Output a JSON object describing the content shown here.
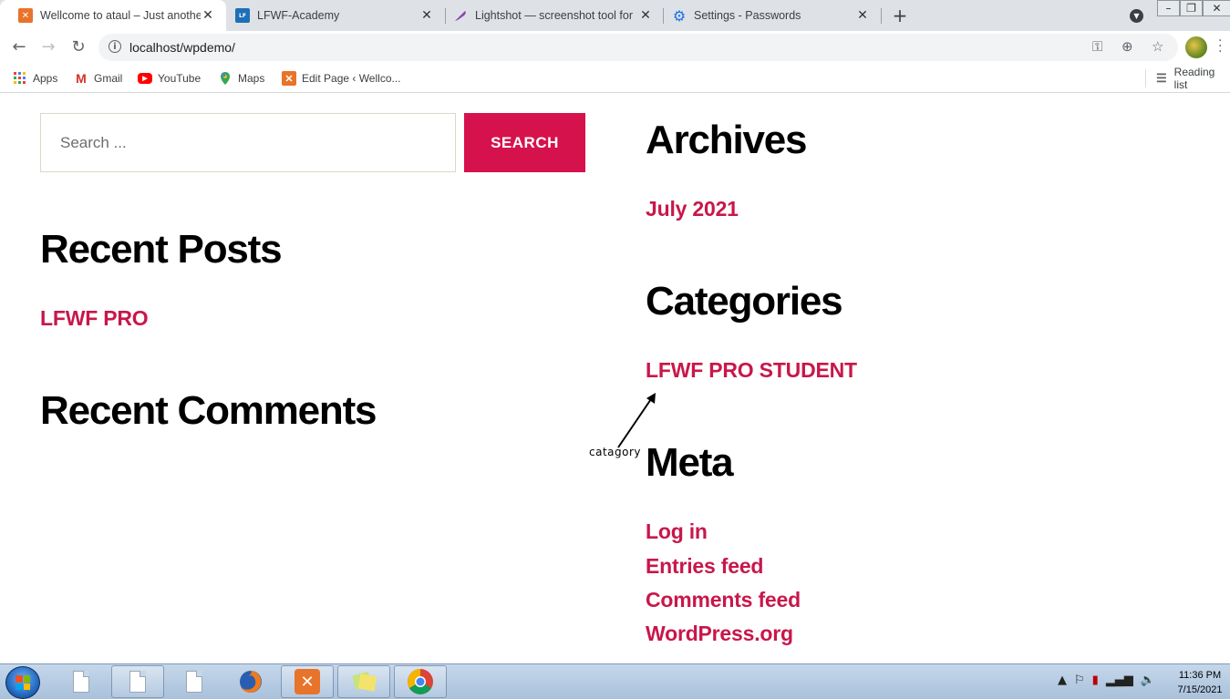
{
  "browser": {
    "tabs": [
      {
        "title": "Wellcome to ataul – Just another",
        "icon": "xampp-icon",
        "active": true
      },
      {
        "title": "LFWF-Academy",
        "icon": "lfwf-icon",
        "active": false
      },
      {
        "title": "Lightshot — screenshot tool for",
        "icon": "feather-icon",
        "active": false
      },
      {
        "title": "Settings - Passwords",
        "icon": "gear-icon",
        "active": false
      }
    ],
    "close_glyph": "✕",
    "new_tab_glyph": "+",
    "address": "localhost/wpdemo/",
    "bookmarks": [
      {
        "label": "Apps",
        "icon": "apps-grid-icon"
      },
      {
        "label": "Gmail",
        "icon": "gmail-icon"
      },
      {
        "label": "YouTube",
        "icon": "youtube-icon"
      },
      {
        "label": "Maps",
        "icon": "maps-icon"
      },
      {
        "label": "Edit Page ‹ Wellco...",
        "icon": "xampp-icon"
      }
    ],
    "reading_list": "Reading list"
  },
  "page": {
    "search": {
      "placeholder": "Search ...",
      "button_label": "SEARCH"
    },
    "recent_posts": {
      "title": "Recent Posts",
      "items": [
        "LFWF PRO"
      ]
    },
    "recent_comments": {
      "title": "Recent Comments"
    },
    "archives": {
      "title": "Archives",
      "items": [
        "July 2021"
      ]
    },
    "categories": {
      "title": "Categories",
      "items": [
        "LFWF PRO STUDENT"
      ]
    },
    "meta": {
      "title": "Meta",
      "items": [
        "Log in",
        "Entries feed",
        "Comments feed",
        "WordPress.org"
      ]
    },
    "annotation": "catagory",
    "accent_color": "#c8174b",
    "button_color": "#d6124c"
  },
  "taskbar": {
    "time": "11:36 PM",
    "date": "7/15/2021"
  }
}
